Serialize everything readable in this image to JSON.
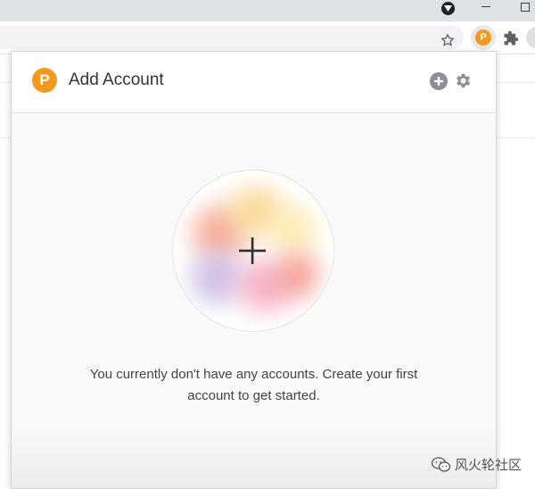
{
  "popup": {
    "title": "Add Account",
    "logo_glyph": "P",
    "empty_message_line1": "You currently don't have any accounts. Create your first",
    "empty_message_line2": "account to get started.",
    "accent_color": "#f39a1e"
  },
  "toolbar": {
    "extension_glyph": "P",
    "icons": [
      "star-icon",
      "pocket-extension-icon",
      "puzzle-icon"
    ]
  },
  "header_icons": [
    "add-account-icon",
    "settings-gear-icon"
  ],
  "watermark": {
    "text": "风火轮社区"
  }
}
